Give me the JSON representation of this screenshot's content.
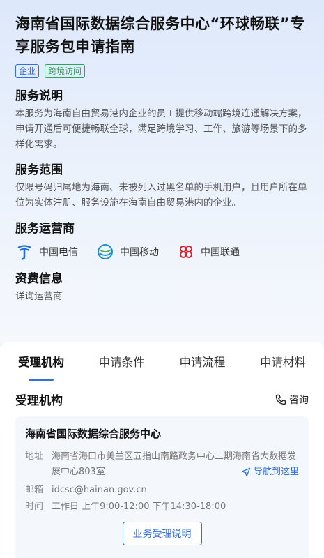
{
  "header": {
    "title": "海南省国际数据综合服务中心“环球畅联”专享服务包申请指南",
    "tags": [
      "企业",
      "跨境访问"
    ]
  },
  "sections": {
    "description": {
      "title": "服务说明",
      "text": "本服务为海南自由贸易港内企业的员工提供移动端跨境连通解决方案，申请开通后可便捷畅联全球，满足跨境学习、工作、旅游等场景下的多样化需求。"
    },
    "scope": {
      "title": "服务范围",
      "text": "仅限号码归属地为海南、未被列入过黑名单的手机用户，且用户所在单位为实体注册、服务设施在海南自由贸易港内的企业。"
    },
    "operators": {
      "title": "服务运营商",
      "items": [
        "中国电信",
        "中国移动",
        "中国联通"
      ]
    },
    "fees": {
      "title": "资费信息",
      "text": "详询运营商"
    }
  },
  "tabs": [
    "受理机构",
    "申请条件",
    "申请流程",
    "申请材料"
  ],
  "agency": {
    "section_title": "受理机构",
    "consult_label": "咨询",
    "name": "海南省国际数据综合服务中心",
    "address_label": "地址",
    "address": "海南省海口市美兰区五指山南路政务中心二期海南省大数据发展中心803室",
    "navigate_label": "导航到这里",
    "email_label": "邮箱",
    "email": "idcsc@hainan.gov.cn",
    "time_label": "时间",
    "time": "工作日 上午9:00-12:00 下午14:30-18:00",
    "button_label": "业务受理说明"
  },
  "colors": {
    "accent": "#2f6fde",
    "tag_green": "#2aa55a",
    "telecom": "#1e6fd6",
    "mobile": "#1b8fd1",
    "unicom": "#d9232d"
  }
}
